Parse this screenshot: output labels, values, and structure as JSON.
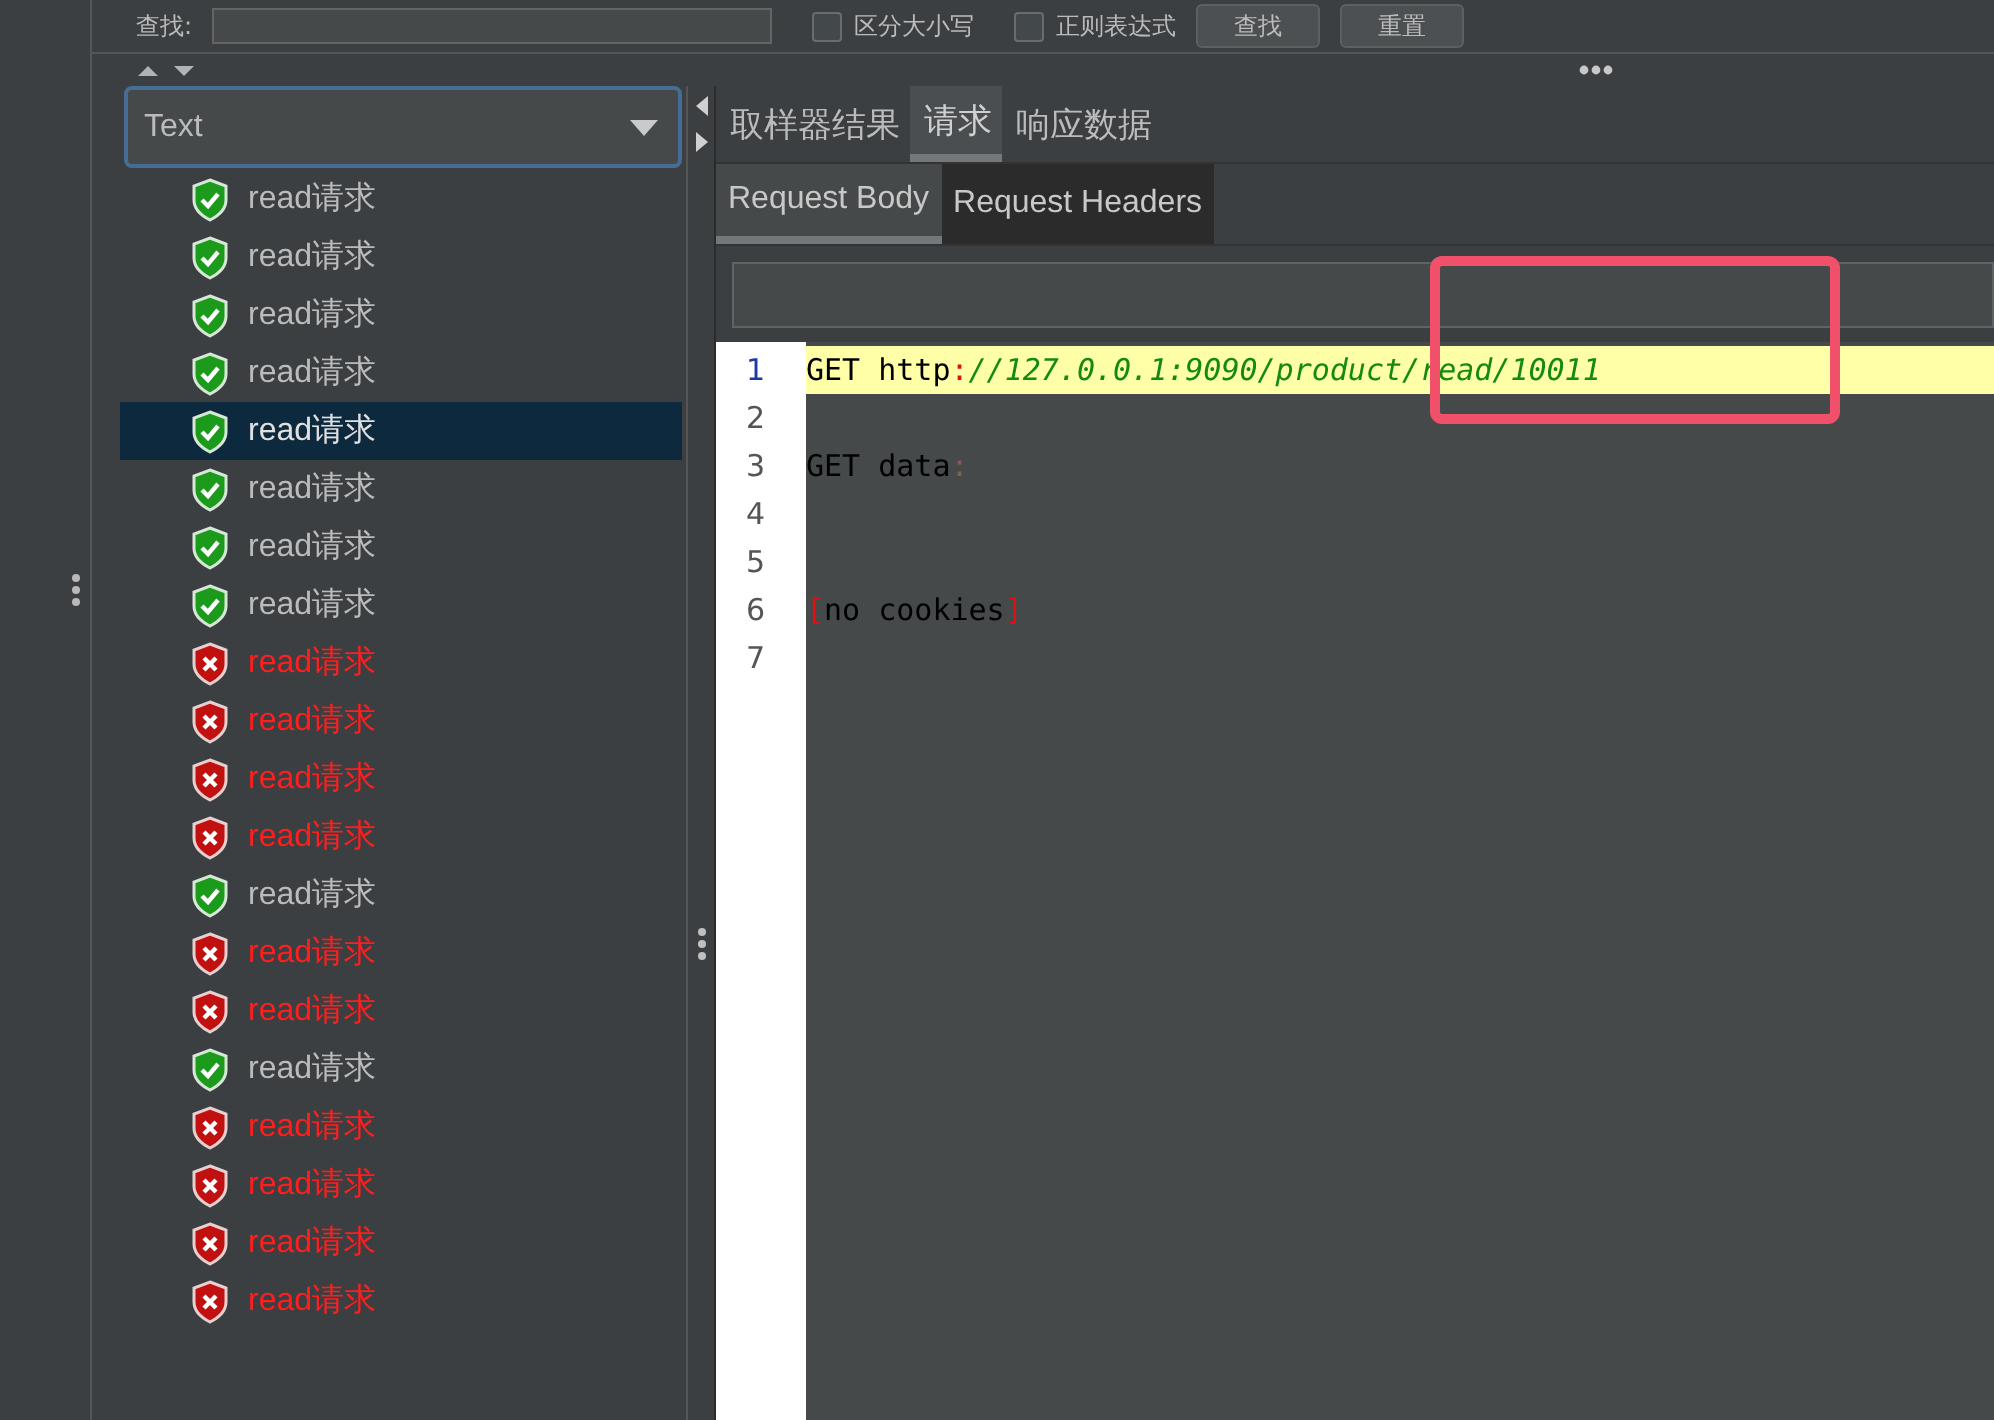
{
  "search_bar": {
    "label": "查找:",
    "checkboxes": [
      {
        "label": "区分大小写",
        "checked": false
      },
      {
        "label": "正则表达式",
        "checked": false
      }
    ],
    "buttons": [
      "查找",
      "重置"
    ]
  },
  "result_tree": {
    "renderer": "Text",
    "items": [
      {
        "label": "read请求",
        "passed": true,
        "selected": false
      },
      {
        "label": "read请求",
        "passed": true,
        "selected": false
      },
      {
        "label": "read请求",
        "passed": true,
        "selected": false
      },
      {
        "label": "read请求",
        "passed": true,
        "selected": false
      },
      {
        "label": "read请求",
        "passed": true,
        "selected": true
      },
      {
        "label": "read请求",
        "passed": true,
        "selected": false
      },
      {
        "label": "read请求",
        "passed": true,
        "selected": false
      },
      {
        "label": "read请求",
        "passed": true,
        "selected": false
      },
      {
        "label": "read请求",
        "passed": false,
        "selected": false
      },
      {
        "label": "read请求",
        "passed": false,
        "selected": false
      },
      {
        "label": "read请求",
        "passed": false,
        "selected": false
      },
      {
        "label": "read请求",
        "passed": false,
        "selected": false
      },
      {
        "label": "read请求",
        "passed": true,
        "selected": false
      },
      {
        "label": "read请求",
        "passed": false,
        "selected": false
      },
      {
        "label": "read请求",
        "passed": false,
        "selected": false
      },
      {
        "label": "read请求",
        "passed": true,
        "selected": false
      },
      {
        "label": "read请求",
        "passed": false,
        "selected": false
      },
      {
        "label": "read请求",
        "passed": false,
        "selected": false
      },
      {
        "label": "read请求",
        "passed": false,
        "selected": false
      },
      {
        "label": "read请求",
        "passed": false,
        "selected": false
      }
    ]
  },
  "tabs": [
    {
      "label": "取样器结果",
      "selected": false
    },
    {
      "label": "请求",
      "selected": true
    },
    {
      "label": "响应数据",
      "selected": false
    }
  ],
  "sub_tabs": [
    {
      "label": "Request Body",
      "selected": true
    },
    {
      "label": "Request Headers",
      "selected": false
    }
  ],
  "editor": {
    "lines": [
      {
        "number": "1",
        "highlighted": true,
        "segments": [
          {
            "kind": "plain",
            "text": "GET http"
          },
          {
            "kind": "punct",
            "text": ":"
          },
          {
            "kind": "url",
            "text": "//127.0.0.1:9090/product/read/10011"
          }
        ]
      },
      {
        "number": "2",
        "highlighted": false
      },
      {
        "number": "3",
        "highlighted": false,
        "segments": [
          {
            "kind": "plain",
            "text": "GET data"
          },
          {
            "kind": "faint",
            "text": ":"
          }
        ]
      },
      {
        "number": "4",
        "highlighted": false
      },
      {
        "number": "5",
        "highlighted": false
      },
      {
        "number": "6",
        "highlighted": false,
        "segments": [
          {
            "kind": "punct",
            "text": "["
          },
          {
            "kind": "plain",
            "text": "no cookies"
          },
          {
            "kind": "punct",
            "text": "]"
          }
        ]
      },
      {
        "number": "7",
        "highlighted": false
      }
    ]
  },
  "annotation": {
    "kind": "highlight-box",
    "color": "#f0506a"
  }
}
